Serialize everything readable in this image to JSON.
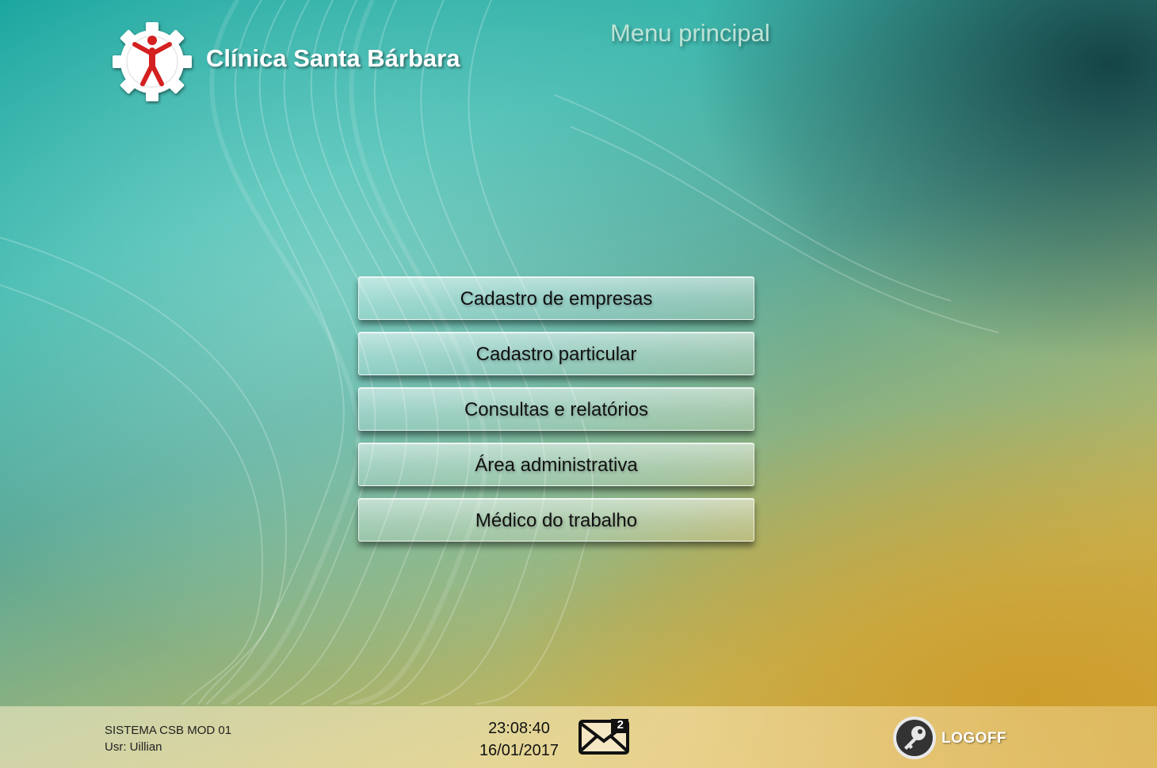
{
  "header": {
    "brand_name": "Clínica Santa Bárbara",
    "menu_title": "Menu principal"
  },
  "menu": {
    "items": [
      {
        "label": "Cadastro de empresas"
      },
      {
        "label": "Cadastro particular"
      },
      {
        "label": "Consultas e relatórios"
      },
      {
        "label": "Área administrativa"
      },
      {
        "label": "Médico do trabalho"
      }
    ]
  },
  "footer": {
    "system_name": "SISTEMA CSB MOD 01",
    "user": "Usr: Uillian",
    "time": "23:08:40",
    "date": "16/01/2017",
    "mail_count": "2",
    "mail_icon": "envelope-icon",
    "logoff_label": "LOGOFF",
    "logoff_icon": "key-icon"
  },
  "colors": {
    "logo_red": "#d42020",
    "title_color": "#bde3d6",
    "footer_bg": "#f6e7c4"
  }
}
